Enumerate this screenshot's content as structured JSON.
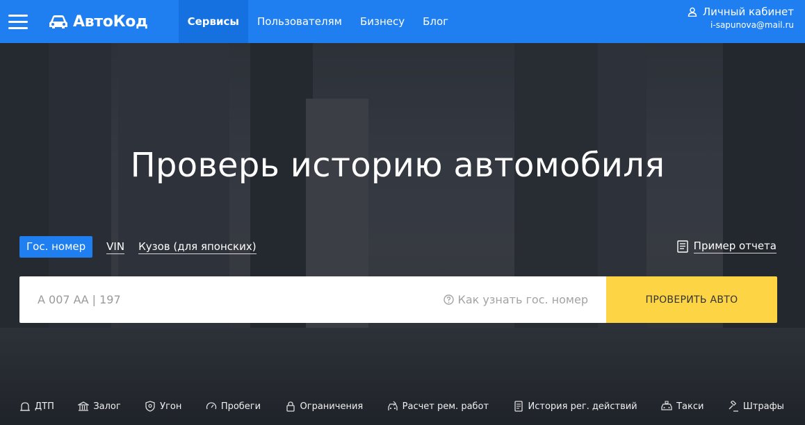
{
  "header": {
    "logo_text": "АвтоКод",
    "nav": [
      {
        "label": "Сервисы",
        "active": true
      },
      {
        "label": "Пользователям",
        "active": false
      },
      {
        "label": "Бизнесу",
        "active": false
      },
      {
        "label": "Блог",
        "active": false
      }
    ],
    "account_label": "Личный кабинет",
    "account_email": "i-sapunova@mail.ru"
  },
  "hero": {
    "headline": "Проверь историю автомобиля",
    "tabs": [
      {
        "label": "Гос. номер",
        "active": true
      },
      {
        "label": "VIN",
        "active": false
      },
      {
        "label": "Кузов (для японских)",
        "active": false
      }
    ],
    "example_report": "Пример отчета",
    "search_placeholder": "А 007 АА | 197",
    "hint": "Как узнать гос. номер",
    "button": "ПРОВЕРИТЬ АВТО"
  },
  "services": [
    {
      "icon": "crash-icon",
      "label": "ДТП"
    },
    {
      "icon": "bank-icon",
      "label": "Залог"
    },
    {
      "icon": "shield-icon",
      "label": "Угон"
    },
    {
      "icon": "speedometer-icon",
      "label": "Пробеги"
    },
    {
      "icon": "lock-icon",
      "label": "Ограничения"
    },
    {
      "icon": "wrench-car-icon",
      "label": "Расчет рем. работ"
    },
    {
      "icon": "document-icon",
      "label": "История рег. действий"
    },
    {
      "icon": "taxi-icon",
      "label": "Такси"
    },
    {
      "icon": "gavel-icon",
      "label": "Штрафы"
    }
  ],
  "colors": {
    "header_bg": "#1f7ff0",
    "active_tab": "#1f7ff0",
    "button_bg": "#fdd443"
  }
}
